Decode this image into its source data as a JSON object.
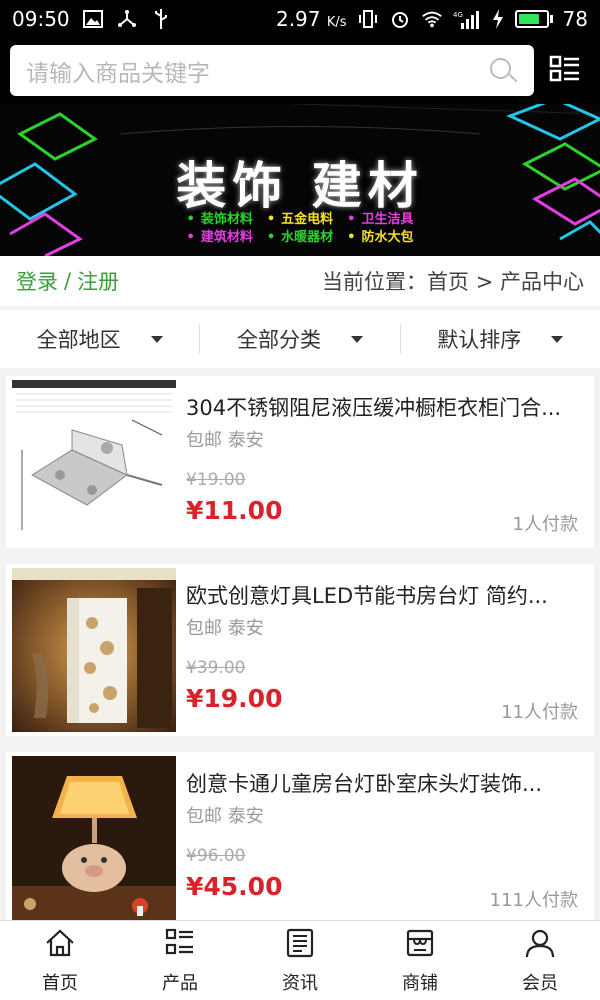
{
  "status_bar": {
    "time": "09:50",
    "speed": "2.97",
    "speed_unit": "K/s",
    "network": "4G",
    "battery": "78",
    "battery_level": 0.78,
    "battery_color": "#2ee65b",
    "left_icons": [
      "image-icon",
      "usb-share-icon",
      "usb-icon"
    ],
    "right_icons": [
      "vibrate-icon",
      "alarm-icon",
      "wifi-icon",
      "signal-icon",
      "charging-icon"
    ]
  },
  "search": {
    "placeholder": "请输入商品关键字",
    "icon": "search-icon",
    "menu_icon": "grid-menu-icon"
  },
  "banner": {
    "title": "装饰 建材",
    "tags_row1": [
      "装饰材料",
      "五金电料",
      "卫生洁具"
    ],
    "tags_row2": [
      "建筑材料",
      "水暖器材",
      "防水大包"
    ],
    "tag_colors_row1": [
      "#2bd32b",
      "#f3e02a",
      "#e33fe3"
    ],
    "tag_colors_row2": [
      "#e33fe3",
      "#2bd32b",
      "#f3e02a"
    ]
  },
  "breadcrumb": {
    "login": "登录",
    "separator": "/",
    "register": "注册",
    "current": "当前位置：首页 > 产品中心"
  },
  "filters": [
    {
      "label": "全部地区"
    },
    {
      "label": "全部分类"
    },
    {
      "label": "默认排序"
    }
  ],
  "products": [
    {
      "title": "304不锈钢阻尼液压缓冲橱柜衣柜门合...",
      "location": "包邮 泰安",
      "old_price": "¥19.00",
      "price": "¥11.00",
      "sold": "1人付款",
      "image": "hinge-image"
    },
    {
      "title": "欧式创意灯具LED节能书房台灯 简约...",
      "location": "包邮 泰安",
      "old_price": "¥39.00",
      "price": "¥19.00",
      "sold": "11人付款",
      "image": "lamp-image"
    },
    {
      "title": "创意卡通儿童房台灯卧室床头灯装饰...",
      "location": "包邮 泰安",
      "old_price": "¥96.00",
      "price": "¥45.00",
      "sold": "111人付款",
      "image": "kids-lamp-image"
    }
  ],
  "nav": [
    {
      "label": "首页",
      "icon": "home-icon"
    },
    {
      "label": "产品",
      "icon": "list-icon"
    },
    {
      "label": "资讯",
      "icon": "news-icon"
    },
    {
      "label": "商铺",
      "icon": "shop-icon"
    },
    {
      "label": "会员",
      "icon": "user-icon"
    }
  ]
}
